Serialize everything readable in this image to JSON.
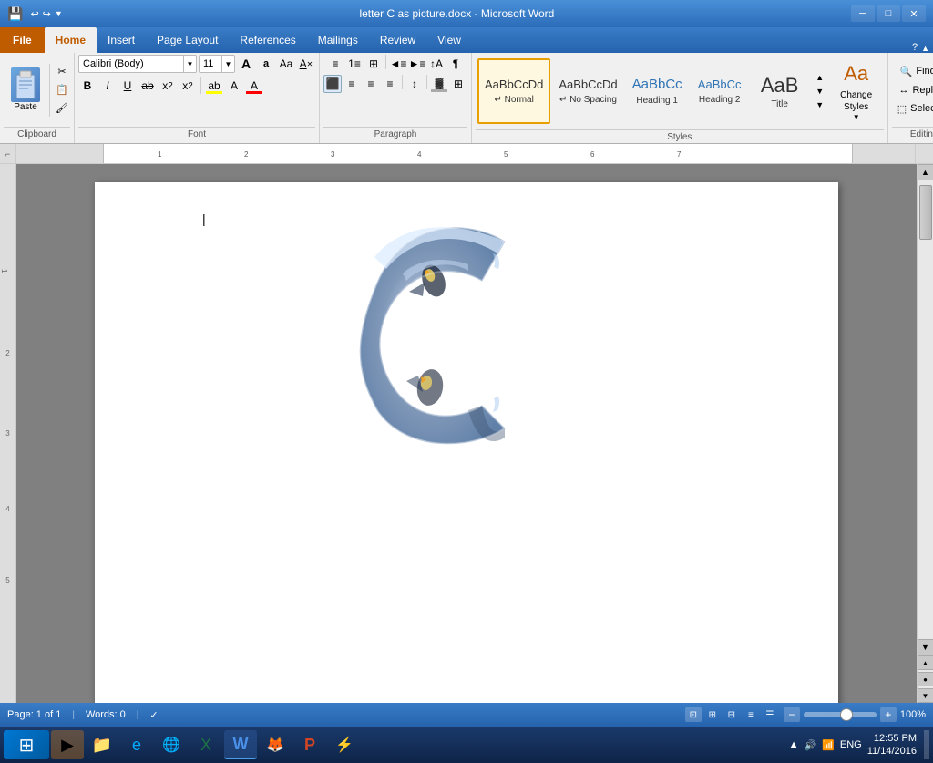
{
  "titlebar": {
    "title": "letter C as picture.docx - Microsoft Word",
    "minimize": "─",
    "maximize": "□",
    "close": "✕"
  },
  "quickaccess": {
    "save": "💾",
    "undo": "↩",
    "redo": "↪",
    "more": "▼"
  },
  "ribbontabs": {
    "file": "File",
    "tabs": [
      "Home",
      "Insert",
      "Page Layout",
      "References",
      "Mailings",
      "Review",
      "View"
    ]
  },
  "ribbon": {
    "clipboard": {
      "label": "Clipboard",
      "paste": "Paste"
    },
    "font": {
      "label": "Font",
      "fontname": "Calibri (Body)",
      "fontsize": "11",
      "bold": "B",
      "italic": "I",
      "underline": "U",
      "strikethrough": "ab",
      "subscript": "x₂",
      "superscript": "x²",
      "clearformat": "A",
      "textcolor_label": "A",
      "highlight_label": "A",
      "fontcolor_label": "A",
      "grow": "A",
      "shrink": "a",
      "case": "Aa",
      "clearall": "✕A"
    },
    "paragraph": {
      "label": "Paragraph",
      "bullets": "≡",
      "numbering": "1≡",
      "multilevel": "⊞≡",
      "decreaseindent": "◄≡",
      "increaseindent": "►≡",
      "sort": "↕A",
      "showmarks": "¶",
      "alignleft": "≡",
      "aligncenter": "≡",
      "alignright": "≡",
      "justify": "≡",
      "linespace": "↕",
      "shading": "▓",
      "borders": "⊞"
    },
    "styles": {
      "label": "Styles",
      "normal_top": "AaBbCcDd",
      "normal_label": "↵ Normal",
      "nospacing_top": "AaBbCcDd",
      "nospacing_label": "↵ No Spacing",
      "h1_top": "AaBbCc",
      "h1_label": "Heading 1",
      "h2_top": "AaBbCc",
      "h2_label": "Heading 2",
      "title_top": "AaB",
      "title_label": "Title",
      "changestyles": "Change\nStyles",
      "scroll_up": "▲",
      "scroll_down": "▼",
      "scroll_more": "▼"
    },
    "editing": {
      "label": "Editing",
      "find": "Find",
      "replace": "Replace",
      "select": "Select",
      "find_icon": "🔍",
      "replace_icon": "↔",
      "select_icon": "⬚"
    }
  },
  "statusbar": {
    "page": "Page: 1 of 1",
    "words": "Words: 0",
    "lang": "🔍",
    "zoom": "100%",
    "zoom_minus": "−",
    "zoom_plus": "+"
  },
  "taskbar": {
    "start_icon": "⊞",
    "apps": [
      {
        "icon": "🎵",
        "color": "#ff8c00",
        "name": "media"
      },
      {
        "icon": "📁",
        "color": "#ffb900",
        "name": "explorer"
      },
      {
        "icon": "🌐",
        "color": "#0078d7",
        "name": "ie"
      },
      {
        "icon": "🌐",
        "color": "#4caf50",
        "name": "chrome"
      },
      {
        "icon": "📊",
        "color": "#217346",
        "name": "excel"
      },
      {
        "icon": "📝",
        "color": "#2b579a",
        "name": "word"
      },
      {
        "icon": "🦊",
        "color": "#ff6611",
        "name": "firefox"
      },
      {
        "icon": "📊",
        "color": "#d04000",
        "name": "ppt"
      },
      {
        "icon": "⚡",
        "color": "#ffc107",
        "name": "app"
      }
    ],
    "time": "12:55 PM",
    "date": "11/14/2016",
    "systray": "▲ 🔊 📶"
  }
}
